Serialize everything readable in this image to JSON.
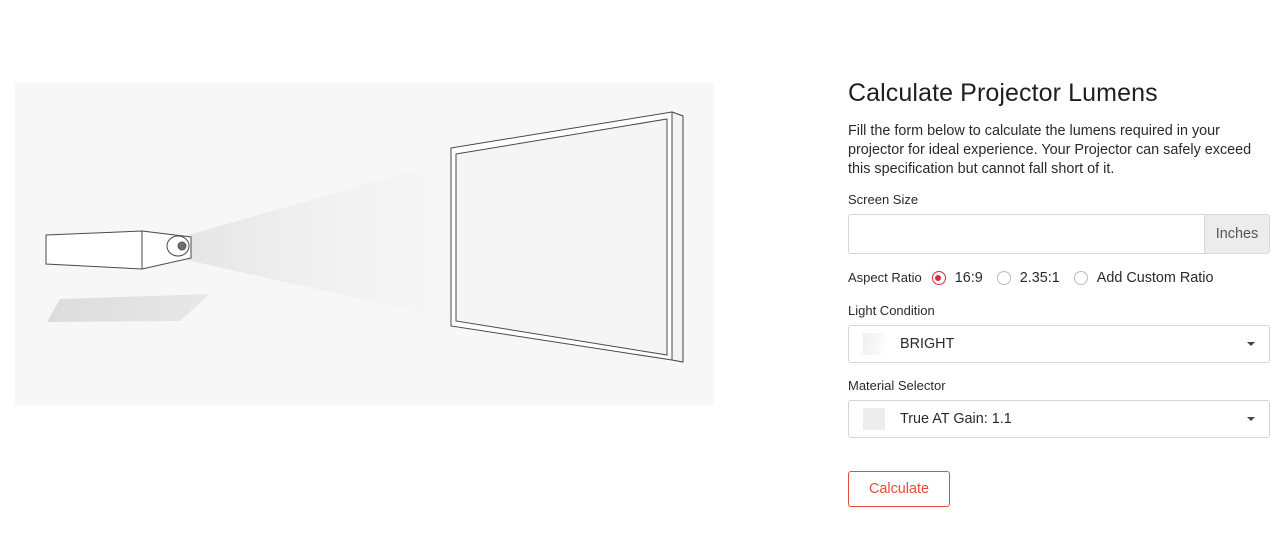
{
  "title": "Calculate Projector Lumens",
  "description": "Fill the form below to calculate the lumens required in your projector for ideal experience. Your Projector can safely exceed this specification but cannot fall short of it.",
  "screen_size": {
    "label": "Screen Size",
    "value": "",
    "placeholder": "",
    "unit": "Inches"
  },
  "aspect_ratio": {
    "label": "Aspect Ratio",
    "options": [
      "16:9",
      "2.35:1",
      "Add Custom Ratio"
    ],
    "selected": "16:9"
  },
  "light_condition": {
    "label": "Light Condition",
    "selected": "BRIGHT"
  },
  "material": {
    "label": "Material Selector",
    "selected": "True AT Gain: 1.1"
  },
  "calculate_label": "Calculate",
  "colors": {
    "accent": "#e84a3c",
    "radio_selected": "#d62f3c",
    "illustration_bg": "#f7f7f7"
  },
  "icons": {
    "dropdown": "caret-down-icon",
    "illustration": "projector-screen-illustration"
  }
}
